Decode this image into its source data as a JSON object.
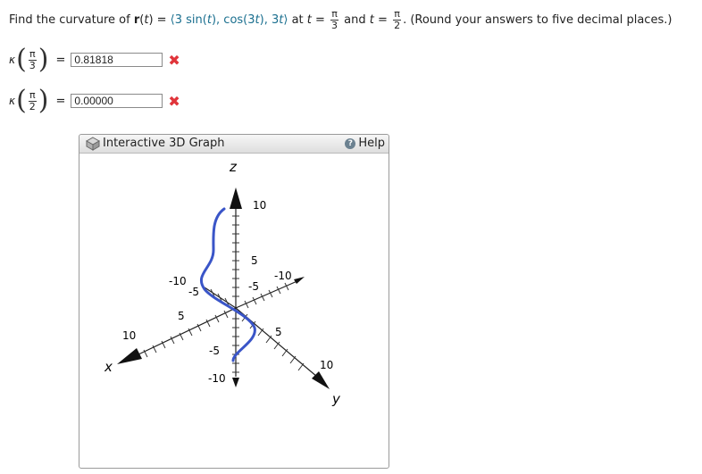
{
  "question": {
    "prefix": "Find the curvature of ",
    "r": "r",
    "t1": "(",
    "t": "t",
    "t2": ") = ",
    "open": "⟨",
    "c1": "3 sin(",
    "c1b": "), cos(3",
    "c2b": "), 3",
    "close": "⟩",
    "at": " at ",
    "eq": " = ",
    "pi": "π",
    "den1": "3",
    "and": " and ",
    "den2": "2",
    "suffix": ".  (Round your answers to five decimal places.)"
  },
  "answers": [
    {
      "kappa": "κ",
      "pi": "π",
      "den": "3",
      "eq": "=",
      "value": "0.81818",
      "status": "incorrect"
    },
    {
      "kappa": "κ",
      "pi": "π",
      "den": "2",
      "eq": "=",
      "value": "0.00000",
      "status": "incorrect"
    }
  ],
  "graph": {
    "title": "Interactive 3D Graph",
    "help": "Help",
    "axes": {
      "x": "x",
      "y": "y",
      "z": "z"
    },
    "z_ticks": [
      "10",
      "5",
      "-5",
      "-10"
    ],
    "x_ticks": [
      "10",
      "5",
      "-5",
      "-10"
    ],
    "y_ticks": [
      "-10",
      "-5",
      "5",
      "10"
    ],
    "curve_color": "#3a55c8",
    "icons": {
      "graph": "3d-cube-icon",
      "help": "help-icon",
      "incorrect": "x-mark-icon"
    }
  }
}
